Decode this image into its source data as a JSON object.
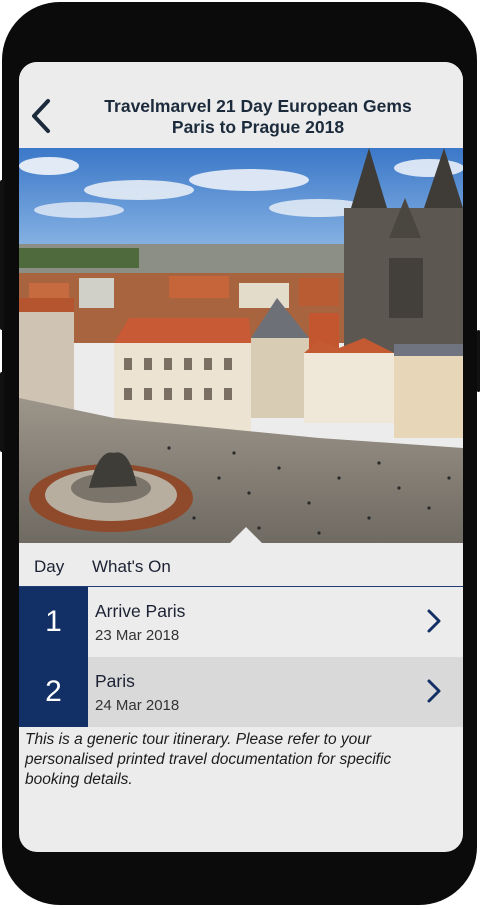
{
  "header": {
    "title_line1": "Travelmarvel 21 Day European Gems",
    "title_line2": "Paris to Prague 2018",
    "back_icon": "chevron-left-icon"
  },
  "hero": {
    "image": "aerial view of Prague Old Town Square"
  },
  "table": {
    "col_day": "Day",
    "col_whats_on": "What's On",
    "rows": [
      {
        "day": "1",
        "title": "Arrive Paris",
        "date": "23 Mar 2018"
      },
      {
        "day": "2",
        "title": "Paris",
        "date": "24 Mar 2018"
      }
    ],
    "chevron_icon": "chevron-right-icon"
  },
  "note": "This is a generic tour itinerary. Please refer to your personalised printed travel documentation for specific booking details.",
  "colors": {
    "accent": "#123066",
    "header_text": "#1c2b3c",
    "row1_bg": "#ececec",
    "row2_bg": "#d9d9d9"
  }
}
